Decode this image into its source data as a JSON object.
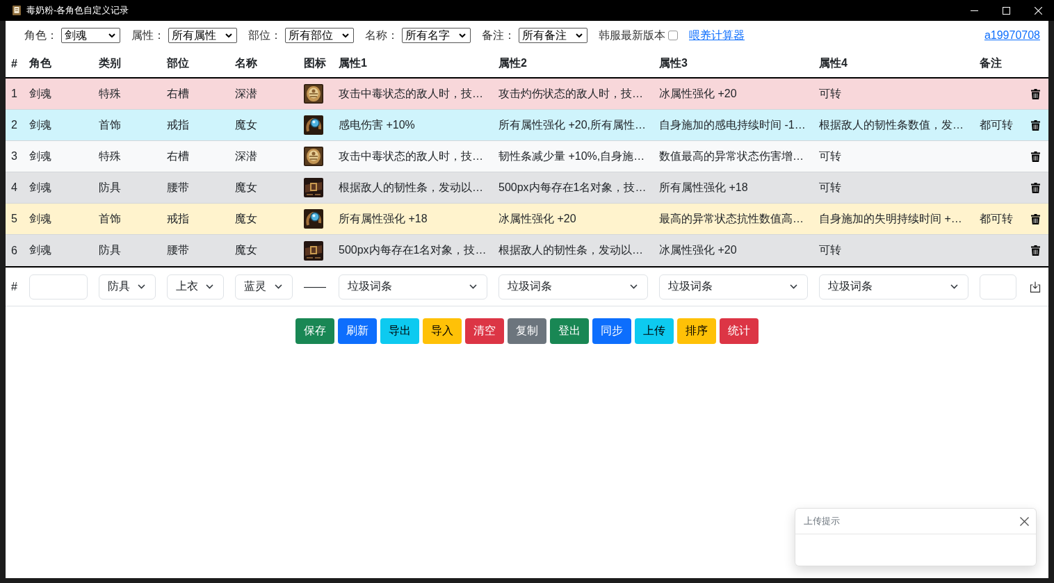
{
  "window": {
    "title": "毒奶粉-各角色自定义记录"
  },
  "filters": [
    {
      "label": "角色：",
      "value": "剑魂"
    },
    {
      "label": "属性：",
      "value": "所有属性"
    },
    {
      "label": "部位：",
      "value": "所有部位"
    },
    {
      "label": "名称：",
      "value": "所有名字"
    },
    {
      "label": "备注：",
      "value": "所有备注"
    }
  ],
  "korean_version": {
    "label": "韩服最新版本",
    "checked": false
  },
  "calculator_link": "喂养计算器",
  "user_link": "a19970708",
  "table": {
    "columns": [
      "#",
      "角色",
      "类别",
      "部位",
      "名称",
      "图标",
      "属性1",
      "属性2",
      "属性3",
      "属性4",
      "备注"
    ],
    "rows": [
      {
        "index": "1",
        "role": "剑魂",
        "category": "特殊",
        "slot": "右槽",
        "name": "深潜",
        "kind": "special",
        "color": "#f8d7da",
        "attrs": [
          "攻击中毒状态的敌人时，技…",
          "攻击灼伤状态的敌人时，技…",
          "冰属性强化 +20",
          "可转"
        ]
      },
      {
        "index": "2",
        "role": "剑魂",
        "category": "首饰",
        "slot": "戒指",
        "name": "魔女",
        "kind": "ring",
        "color": "#cff4fc",
        "attrs": [
          "感电伤害 +10%",
          "所有属性强化 +20,所有属性…",
          "自身施加的感电持续时间 -1…",
          "根据敌人的韧性条数值，发…"
        ],
        "note": "都可转"
      },
      {
        "index": "3",
        "role": "剑魂",
        "category": "特殊",
        "slot": "右槽",
        "name": "深潜",
        "kind": "special",
        "color": "#f8f9fa",
        "attrs": [
          "攻击中毒状态的敌人时，技…",
          "韧性条减少量 +10%,自身施…",
          "数值最高的异常状态伤害增…",
          "可转"
        ]
      },
      {
        "index": "4",
        "role": "剑魂",
        "category": "防具",
        "slot": "腰带",
        "name": "魔女",
        "kind": "belt",
        "color": "#e2e3e5",
        "attrs": [
          "根据敌人的韧性条，发动以…",
          "500px内每存在1名对象，技…",
          "所有属性强化 +18",
          "可转"
        ]
      },
      {
        "index": "5",
        "role": "剑魂",
        "category": "首饰",
        "slot": "戒指",
        "name": "魔女",
        "kind": "ring",
        "color": "#fff3cd",
        "attrs": [
          "所有属性强化 +18",
          "冰属性强化 +20",
          "最高的异常状态抗性数值高…",
          "自身施加的失明持续时间 +…"
        ],
        "note": "都可转"
      },
      {
        "index": "6",
        "role": "剑魂",
        "category": "防具",
        "slot": "腰带",
        "name": "魔女",
        "kind": "belt",
        "color": "#e2e3e5",
        "attrs": [
          "500px内每存在1名对象，技…",
          "根据敌人的韧性条，发动以…",
          "冰属性强化 +20",
          "可转"
        ]
      }
    ]
  },
  "form": {
    "index": "#",
    "category": "防具",
    "slot": "上衣",
    "name": "蓝灵",
    "icon": "——",
    "attrs": [
      "垃圾词条",
      "垃圾词条",
      "垃圾词条",
      "垃圾词条"
    ]
  },
  "buttons": [
    {
      "label": "保存",
      "kind": "success"
    },
    {
      "label": "刷新",
      "kind": "primary"
    },
    {
      "label": "导出",
      "kind": "info"
    },
    {
      "label": "导入",
      "kind": "warning"
    },
    {
      "label": "清空",
      "kind": "danger"
    },
    {
      "label": "复制",
      "kind": "secondary"
    },
    {
      "label": "登出",
      "kind": "success"
    },
    {
      "label": "同步",
      "kind": "primary"
    },
    {
      "label": "上传",
      "kind": "info"
    },
    {
      "label": "排序",
      "kind": "warning"
    },
    {
      "label": "统计",
      "kind": "danger"
    }
  ],
  "toast": {
    "title": "上传提示"
  }
}
